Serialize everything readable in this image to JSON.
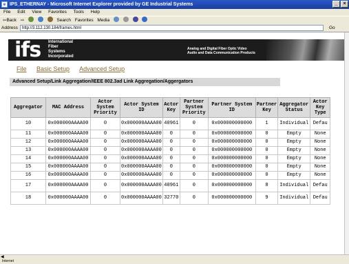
{
  "window": {
    "title": "IPS_ETHERNAY - Microsoft Internet Explorer provided by GE Industrial Systems",
    "minimize_label": "_",
    "close_label": "×"
  },
  "menu": [
    "File",
    "Edit",
    "View",
    "Favorites",
    "Tools",
    "Help"
  ],
  "toolbar": {
    "back": "⇦Back",
    "forward": "⇨",
    "search": "Search",
    "favorites": "Favorites",
    "media": "Media"
  },
  "address": {
    "label": "Address",
    "url": "http://3.112.130.184/frames.html",
    "go": "Go"
  },
  "banner": {
    "logo": "ifs",
    "company_lines": [
      "International",
      "Fiber",
      "Systems",
      "Incorporated"
    ],
    "tagline_1": "Analog and Digital Fiber Optic Video",
    "tagline_2": "Audio and Data Communication Products"
  },
  "nav": [
    "File",
    "Basic Setup",
    "Advanced Setup"
  ],
  "heading": "Advanced Setup/Link Aggregation/IEEE 802.3ad Link Aggregation/Aggergators",
  "table": {
    "headers": [
      "Aggregator",
      "MAC Address",
      "Actor System Priority",
      "Actor System ID",
      "Actor Key",
      "Partner System Priority",
      "Partner System ID",
      "Partner Key",
      "Aggregator Status",
      "Actor Key Type"
    ],
    "rows": [
      [
        "10",
        "0x000000AAAA00",
        "0",
        "0x000000AAAA00",
        "40961",
        "0",
        "0x000000000000",
        "1",
        "Individual",
        "Defau"
      ],
      [
        "11",
        "0x000000AAAA00",
        "0",
        "0x000000AAAA00",
        "0",
        "0",
        "0x000000000000",
        "0",
        "Empty",
        "None"
      ],
      [
        "12",
        "0x000000AAAA00",
        "0",
        "0x000000AAAA00",
        "0",
        "0",
        "0x000000000000",
        "0",
        "Empty",
        "None"
      ],
      [
        "13",
        "0x000000AAAA00",
        "0",
        "0x000000AAAA00",
        "0",
        "0",
        "0x000000000000",
        "0",
        "Empty",
        "None"
      ],
      [
        "14",
        "0x000000AAAA00",
        "0",
        "0x000000AAAA00",
        "0",
        "0",
        "0x000000000000",
        "0",
        "Empty",
        "None"
      ],
      [
        "15",
        "0x000000AAAA00",
        "0",
        "0x000000AAAA00",
        "0",
        "0",
        "0x000000000000",
        "0",
        "Empty",
        "None"
      ],
      [
        "16",
        "0x000000AAAA00",
        "0",
        "0x000000AAAA00",
        "0",
        "0",
        "0x000000000000",
        "0",
        "Empty",
        "None"
      ],
      [
        "17",
        "0x000000AAAA00",
        "0",
        "0x000000AAAA00",
        "40961",
        "0",
        "0x000000000000",
        "8",
        "Individual",
        "Defau"
      ],
      [
        "18",
        "0x000000AAAA00",
        "0",
        "0x000000AAAA00",
        "32770",
        "0",
        "0x000000000000",
        "9",
        "Individual",
        "Defau"
      ]
    ]
  },
  "statusbar": "Internet",
  "colors": {
    "titlebar": "#1a3f9e",
    "nav_link": "#8b6a2e",
    "banner_bg": "#1c1c1c",
    "header_bg": "#dcdcdc"
  }
}
